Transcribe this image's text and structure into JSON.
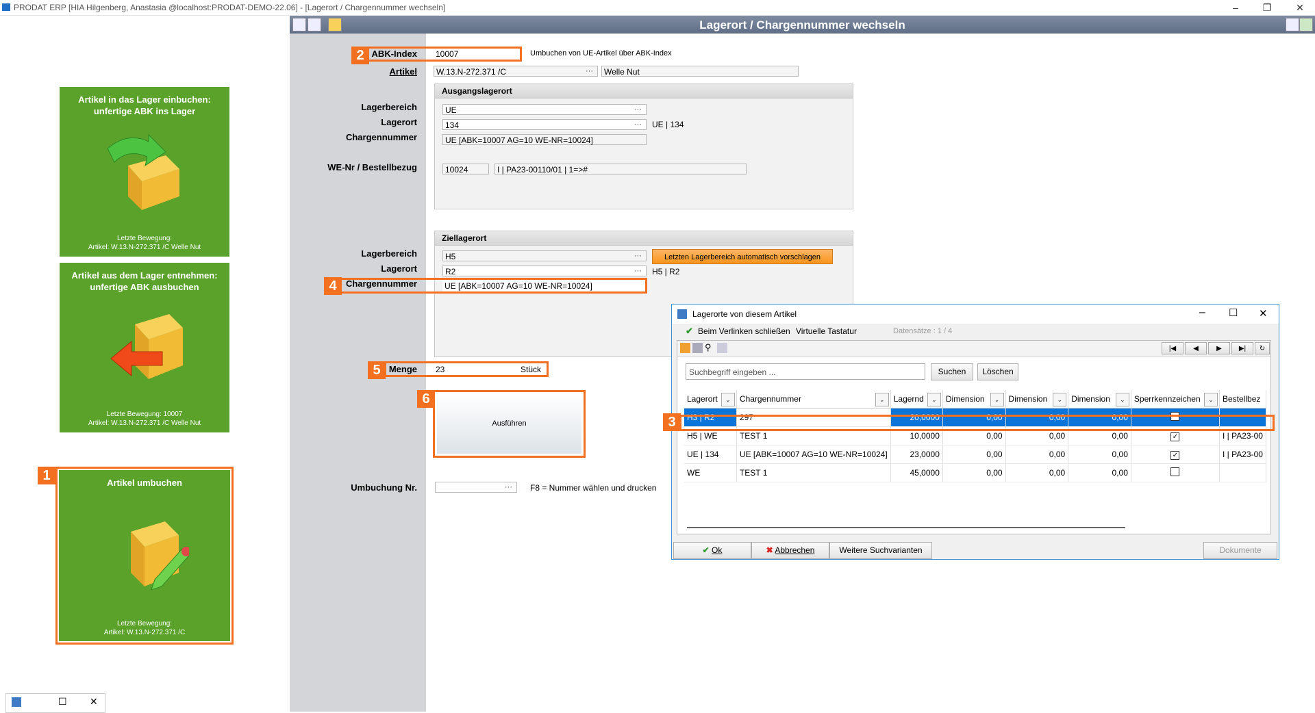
{
  "window": {
    "title": "PRODAT ERP  [HIA Hilgenberg, Anastasia @localhost:PRODAT-DEMO-22.06] - [Lagerort / Chargennummer wechseln]"
  },
  "tiles": [
    {
      "title": "Artikel in das Lager einbuchen: unfertige ABK ins Lager",
      "footer_label": "Letzte Bewegung:",
      "footer_value": "Artikel: W.13.N-272.371 /C Welle Nut"
    },
    {
      "title": "Artikel aus dem Lager entnehmen: unfertige ABK ausbuchen",
      "footer_label": "Letzte Bewegung: 10007",
      "footer_value": "Artikel: W.13.N-272.371 /C Welle Nut"
    },
    {
      "title": "Artikel umbuchen",
      "footer_label": "Letzte Bewegung:",
      "footer_value": "Artikel: W.13.N-272.371 /C"
    }
  ],
  "badges": {
    "b1": "1",
    "b2": "2",
    "b3": "3",
    "b4": "4",
    "b5": "5",
    "b6": "6"
  },
  "form": {
    "title": "Lagerort / Chargennummer wechseln",
    "abk_label": "ABK-Index",
    "abk_value": "10007",
    "abk_note": "Umbuchen von UE-Artikel über ABK-Index",
    "artikel_label": "Artikel",
    "artikel_value": "W.13.N-272.371 /C",
    "artikel_name": "Welle Nut",
    "source": {
      "header": "Ausgangslagerort",
      "lagerbereich_label": "Lagerbereich",
      "lagerbereich": "UE",
      "lagerort_label": "Lagerort",
      "lagerort": "134",
      "lagerort_info": "UE | 134",
      "charge_label": "Chargennummer",
      "charge": "UE [ABK=10007 AG=10 WE-NR=10024]",
      "we_label": "WE-Nr / Bestellbezug",
      "we_nr": "10024",
      "bestellbezug": "I | PA23-00110/01 | 1=>#"
    },
    "target": {
      "header": "Ziellagerort",
      "lagerbereich_label": "Lagerbereich",
      "lagerbereich": "H5",
      "suggest_button": "Letzten Lagerbereich automatisch vorschlagen",
      "lagerort_label": "Lagerort",
      "lagerort": "R2",
      "lagerort_info": "H5 | R2",
      "charge_label": "Chargennummer",
      "charge": "UE [ABK=10007 AG=10 WE-NR=10024]"
    },
    "menge_label": "Menge",
    "menge_value": "23",
    "menge_unit": "Stück",
    "execute_button": "Ausführen",
    "umbuchung_label": "Umbuchung Nr.",
    "umbuchung_value": "",
    "umbuchung_hint": "F8 = Nummer wählen und drucken"
  },
  "dialog": {
    "title": "Lagerorte von diesem Artikel",
    "toolbar_close_on_link": "Beim Verlinken schließen",
    "toolbar_keyboard": "Virtuelle Tastatur",
    "records": "Datensätze : 1 / 4",
    "search_placeholder": "Suchbegriff eingeben ...",
    "search_button": "Suchen",
    "clear_button": "Löschen",
    "columns": [
      "Lagerort",
      "Chargennummer",
      "Lagernd",
      "Dimension",
      "Dimension",
      "Dimension",
      "Sperrkennzeichen",
      "Bestellbez"
    ],
    "rows": [
      {
        "lagerort": "H3 | R2",
        "charge": "297",
        "lagernd": "20,0000",
        "d1": "0,00",
        "d2": "0,00",
        "d3": "0,00",
        "sperr": false,
        "bestell": ""
      },
      {
        "lagerort": "H5 | WE",
        "charge": "TEST 1",
        "lagernd": "10,0000",
        "d1": "0,00",
        "d2": "0,00",
        "d3": "0,00",
        "sperr": true,
        "bestell": "I | PA23-00"
      },
      {
        "lagerort": "UE | 134",
        "charge": "UE [ABK=10007 AG=10 WE-NR=10024]",
        "lagernd": "23,0000",
        "d1": "0,00",
        "d2": "0,00",
        "d3": "0,00",
        "sperr": true,
        "bestell": "I | PA23-00"
      },
      {
        "lagerort": "WE",
        "charge": "TEST 1",
        "lagernd": "45,0000",
        "d1": "0,00",
        "d2": "0,00",
        "d3": "0,00",
        "sperr": false,
        "bestell": ""
      }
    ],
    "ok_button": "Ok",
    "cancel_button": "Abbrechen",
    "more_button": "Weitere Suchvarianten",
    "docs_button": "Dokumente"
  },
  "colors": {
    "accent": "#f37021",
    "tile_green": "#5aa22a",
    "selection": "#0a74d9"
  }
}
